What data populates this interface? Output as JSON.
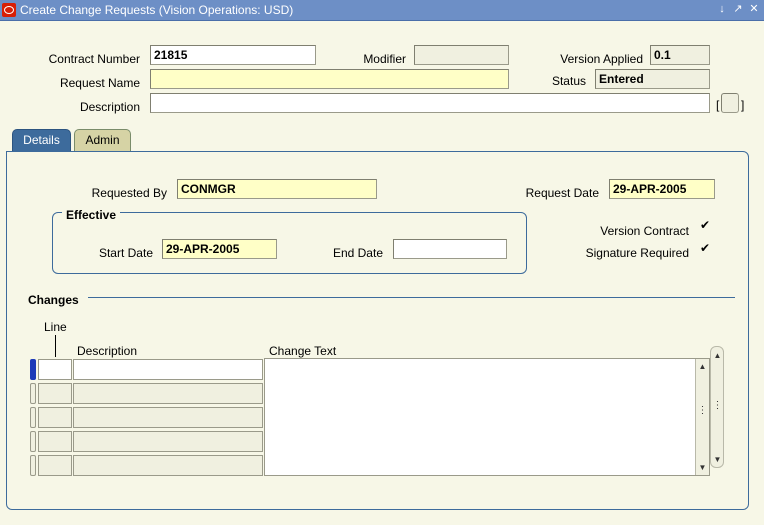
{
  "window": {
    "title": "Create Change Requests (Vision Operations: USD)"
  },
  "header": {
    "contract_number_label": "Contract Number",
    "contract_number_value": "21815",
    "modifier_label": "Modifier",
    "modifier_value": "",
    "version_applied_label": "Version Applied",
    "version_applied_value": "0.1",
    "request_name_label": "Request Name",
    "request_name_value": "",
    "status_label": "Status",
    "status_value": "Entered",
    "description_label": "Description",
    "description_value": "",
    "bracket_left": "[",
    "bracket_right": "]"
  },
  "tabs": [
    {
      "label": "Details",
      "active": true
    },
    {
      "label": "Admin",
      "active": false
    }
  ],
  "details": {
    "requested_by_label": "Requested By",
    "requested_by_value": "CONMGR",
    "request_date_label": "Request Date",
    "request_date_value": "29-APR-2005",
    "effective_title": "Effective",
    "start_date_label": "Start Date",
    "start_date_value": "29-APR-2005",
    "end_date_label": "End Date",
    "end_date_value": "",
    "version_contract_label": "Version Contract",
    "version_contract_checked": true,
    "signature_required_label": "Signature Required",
    "signature_required_checked": true
  },
  "changes": {
    "title": "Changes",
    "col_line": "Line",
    "col_description": "Description",
    "col_change_text": "Change Text",
    "rows": 5,
    "check_glyph": "✔"
  },
  "icons": {
    "minimize": "minimize-icon",
    "maximize": "maximize-icon",
    "close": "close-icon"
  }
}
